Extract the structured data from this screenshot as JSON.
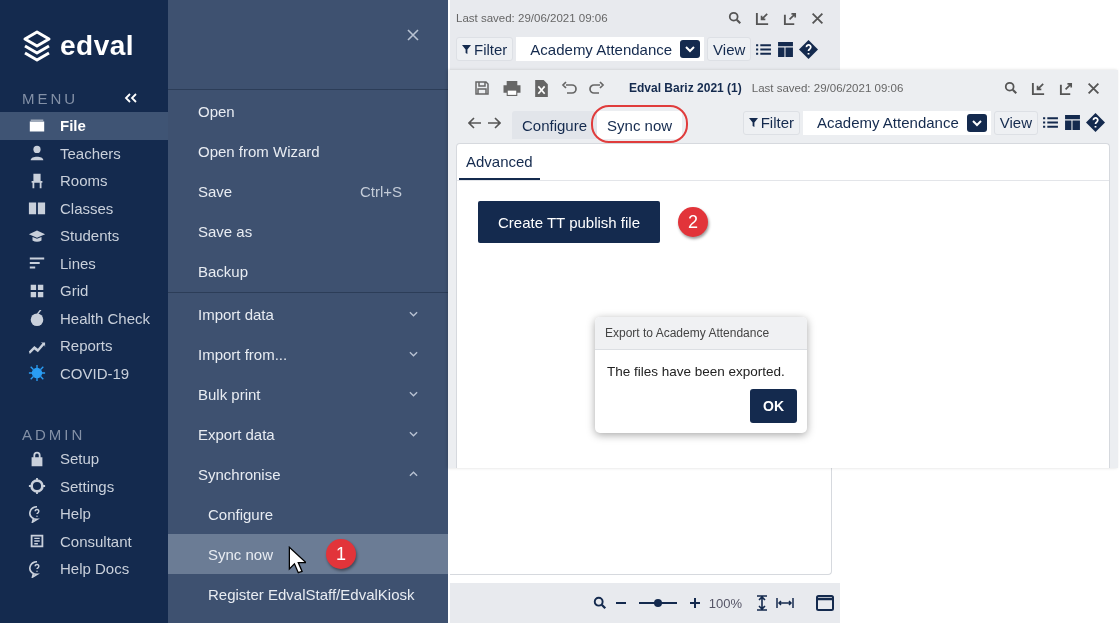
{
  "sidebar": {
    "logo": "edval",
    "menu_heading": "MENU",
    "items": [
      {
        "label": "File",
        "selected": true
      },
      {
        "label": "Teachers",
        "selected": false
      },
      {
        "label": "Rooms",
        "selected": false
      },
      {
        "label": "Classes",
        "selected": false
      },
      {
        "label": "Students",
        "selected": false
      },
      {
        "label": "Lines",
        "selected": false
      },
      {
        "label": "Grid",
        "selected": false
      },
      {
        "label": "Health Check",
        "selected": false
      },
      {
        "label": "Reports",
        "selected": false
      },
      {
        "label": "COVID-19",
        "selected": false
      }
    ],
    "admin_heading": "ADMIN",
    "admin_items": [
      {
        "label": "Setup",
        "selected": false
      },
      {
        "label": "Settings",
        "selected": false
      },
      {
        "label": "Help",
        "selected": false
      },
      {
        "label": "Consultant",
        "selected": false
      },
      {
        "label": "Help Docs",
        "selected": false
      }
    ]
  },
  "file_menu": {
    "groups": [
      [
        {
          "kind": "item",
          "label": "Open",
          "selected": false
        },
        {
          "kind": "item",
          "label": "Open from Wizard",
          "selected": false
        },
        {
          "kind": "item",
          "label": "Save",
          "shortcut": "Ctrl+S",
          "selected": false
        },
        {
          "kind": "item",
          "label": "Save as",
          "selected": false
        },
        {
          "kind": "item",
          "label": "Backup",
          "selected": false
        }
      ],
      [
        {
          "kind": "expandable",
          "label": "Import data",
          "expanded": false,
          "selected": false
        },
        {
          "kind": "expandable",
          "label": "Import from...",
          "expanded": false,
          "selected": false
        },
        {
          "kind": "expandable",
          "label": "Bulk print",
          "expanded": false,
          "selected": false
        },
        {
          "kind": "expandable",
          "label": "Export data",
          "expanded": false,
          "selected": false
        },
        {
          "kind": "expandable",
          "label": "Synchronise",
          "expanded": true,
          "selected": false
        },
        {
          "kind": "sub",
          "label": "Configure",
          "selected": false
        },
        {
          "kind": "sub",
          "label": "Sync now",
          "selected": true,
          "callout": "1"
        },
        {
          "kind": "sub",
          "label": "Register EdvalStaff/EdvalKiosk",
          "selected": false
        }
      ]
    ]
  },
  "back_window": {
    "last_saved": "Last saved: 29/06/2021 09:06",
    "filter": "Filter",
    "dropdown": "Academy Attendance",
    "view": "View",
    "zoom": {
      "level": 0.5,
      "reading": "100%"
    }
  },
  "front_window": {
    "title": "Edval Bariz 2021 (1)",
    "last_saved": "Last saved: 29/06/2021 09:06",
    "tabs": [
      {
        "label": "Configure",
        "selected": false,
        "highlighted": false
      },
      {
        "label": "Sync now",
        "selected": true,
        "highlighted": true
      }
    ],
    "filter": "Filter",
    "dropdown": "Academy Attendance",
    "view": "View",
    "subtabs": [
      {
        "label": "Advanced",
        "selected": true
      }
    ],
    "button": "Create TT publish file",
    "button_callout": "2",
    "dialog": {
      "title": "Export to Academy Attendance",
      "message": "The files have been exported.",
      "ok": "OK"
    }
  }
}
